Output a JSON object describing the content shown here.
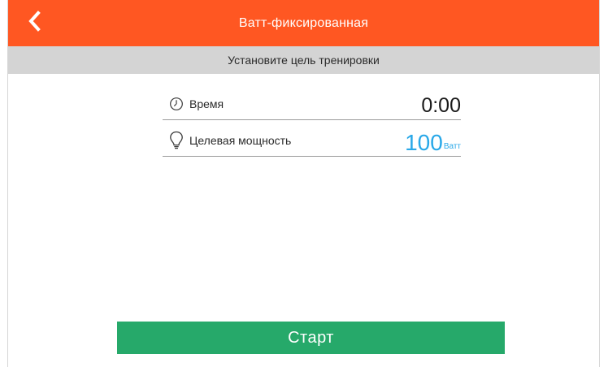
{
  "header": {
    "title": "Ватт-фиксированная",
    "back_icon": "chevron-left-icon",
    "color": "#ff5722"
  },
  "subheader": {
    "text": "Установите цель тренировки",
    "color": "#d4d4d4"
  },
  "settings": {
    "time": {
      "icon": "clock-icon",
      "label": "Время",
      "value": "0:00"
    },
    "power": {
      "icon": "lightbulb-icon",
      "label": "Целевая мощность",
      "value": "100",
      "unit": "Ватт",
      "color": "#29a8e8"
    }
  },
  "actions": {
    "start_label": "Старт",
    "start_color": "#26a96a"
  }
}
